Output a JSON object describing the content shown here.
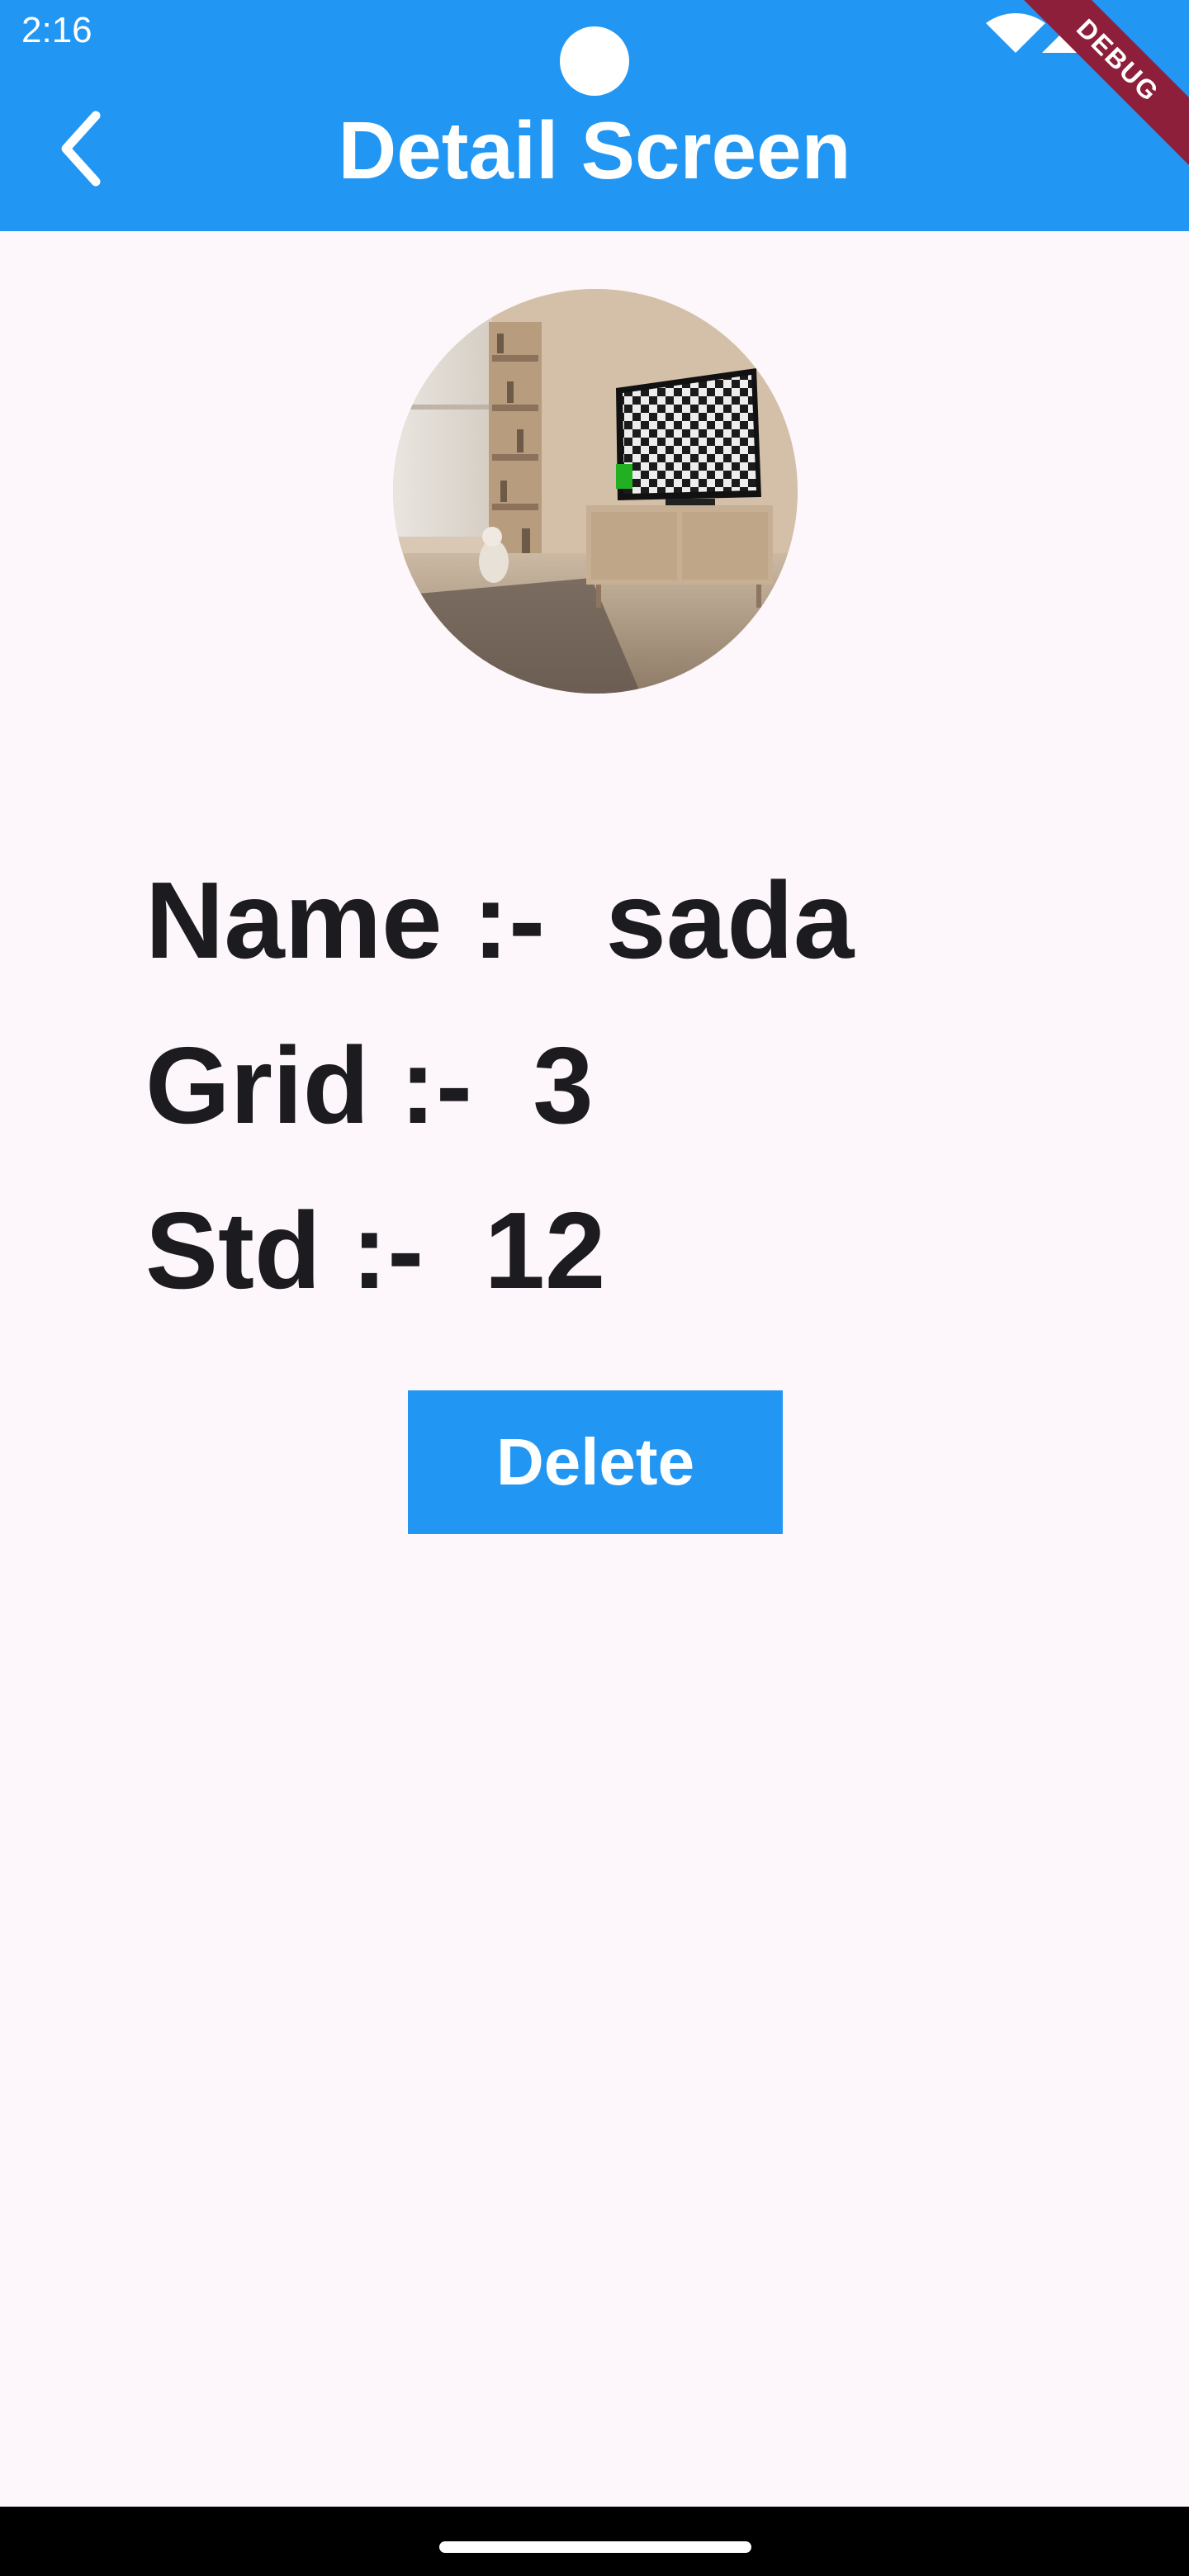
{
  "status_bar": {
    "time": "2:16",
    "icons": [
      "wifi-icon",
      "cell-signal-icon"
    ]
  },
  "debug_banner": "DEBUG",
  "app_bar": {
    "title": "Detail Screen",
    "back_icon": "chevron-left-icon"
  },
  "colors": {
    "primary": "#2196F3",
    "background": "#FDF7FB",
    "text": "#1C1B1F",
    "debug_banner": "#8E1F3A"
  },
  "avatar": {
    "description_icon": "living-room-photo"
  },
  "details": {
    "name": "Name :-  sada",
    "grid": "Grid :-  3",
    "std": "Std :-  12"
  },
  "actions": {
    "delete_label": "Delete"
  }
}
